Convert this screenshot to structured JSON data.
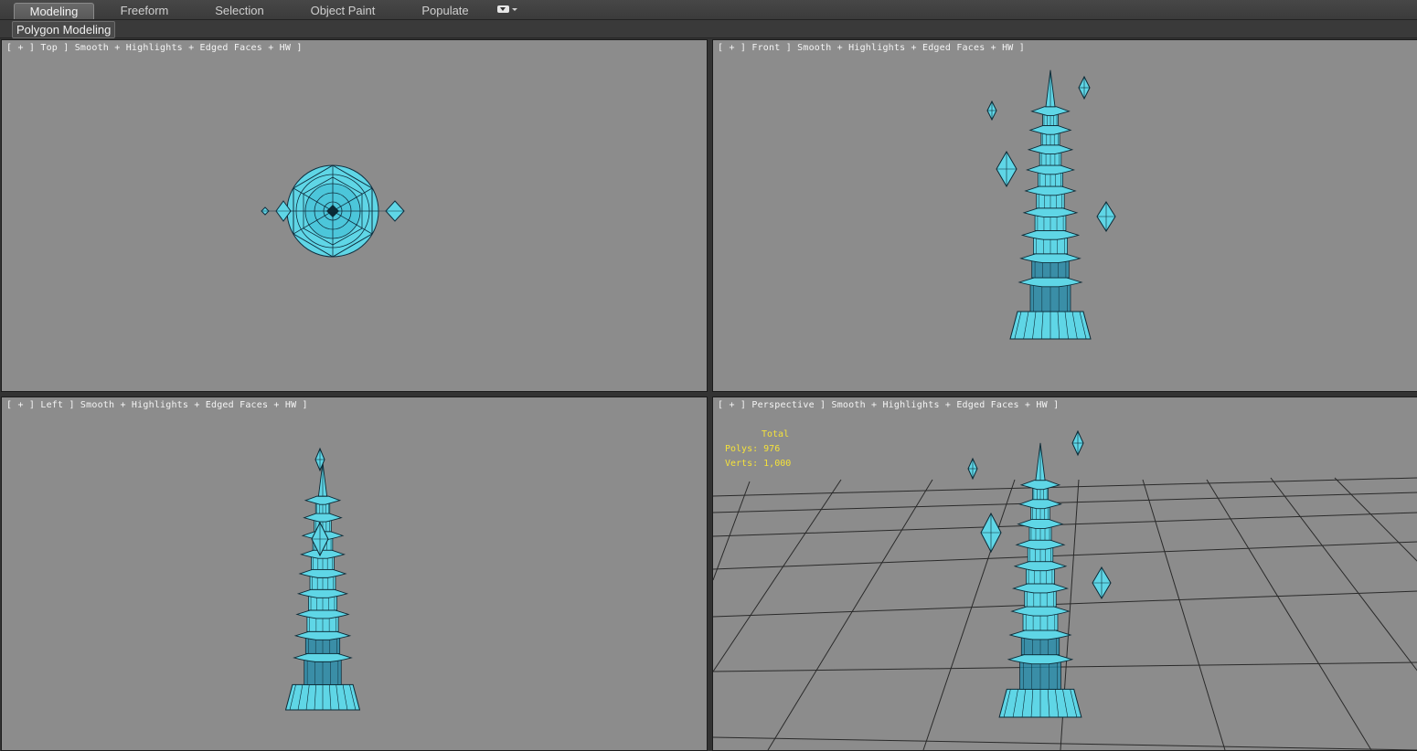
{
  "ribbon": {
    "tabs": [
      "Modeling",
      "Freeform",
      "Selection",
      "Object Paint",
      "Populate"
    ],
    "active_tab": "Modeling",
    "panel_label": "Polygon Modeling"
  },
  "viewports": {
    "top": {
      "plus": "+",
      "view": "Top",
      "shading": "Smooth + Highlights + Edged Faces + HW"
    },
    "front": {
      "plus": "+",
      "view": "Front",
      "shading": "Smooth + Highlights + Edged Faces + HW"
    },
    "left": {
      "plus": "+",
      "view": "Left",
      "shading": "Smooth + Highlights + Edged Faces + HW"
    },
    "perspective": {
      "plus": "+",
      "view": "Perspective",
      "shading": "Smooth + Highlights + Edged Faces + HW"
    }
  },
  "stats": {
    "title": "Total",
    "polys_label": "Polys:",
    "polys_value": "976",
    "verts_label": "Verts:",
    "verts_value": "1,000"
  },
  "colors": {
    "viewport_bg": "#8c8c8c",
    "model_fill": "#5fd6e6",
    "model_dark": "#1f8fb0",
    "stats_text": "#f5e23a",
    "grid_line": "#2a2a2a"
  },
  "icons": {
    "view_menu": "dropdown-icon",
    "tab_overflow": "chevron-down-icon"
  }
}
